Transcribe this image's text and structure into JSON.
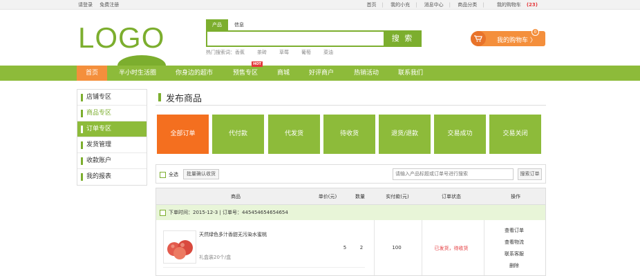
{
  "topbar": {
    "login": "请登录",
    "register": "免费注册",
    "links": [
      "首页",
      "我的小充",
      "消息中心",
      "商品分类",
      "我的购物车"
    ],
    "cart_count": "(23)"
  },
  "header": {
    "logo": "LOGO",
    "search_tabs": [
      "产品",
      "信息"
    ],
    "search_button": "搜 索",
    "hot_label": "热门搜索词：",
    "hot_words": [
      "香蕉",
      "茶砖",
      "草莓",
      "葡萄",
      "菜油"
    ],
    "cart_label": "我的购物车 〉",
    "cart_badge": "0",
    "cart_icon": "shopping-cart-icon"
  },
  "nav": {
    "items": [
      "首页",
      "半小时生活圈",
      "你身边的超市",
      "预售专区",
      "商城",
      "好评商户",
      "热销活动",
      "联系我们"
    ],
    "hot_tag": "HOT"
  },
  "sidebar": {
    "items": [
      "店铺专区",
      "商品专区",
      "订单专区",
      "发货管理",
      "收款账户",
      "我的报表"
    ]
  },
  "main": {
    "title": "发布商品",
    "status_tiles": [
      "全部订单",
      "代付款",
      "代发货",
      "待收货",
      "退货/退款",
      "交易成功",
      "交易关闭"
    ],
    "toolbar": {
      "select_all": "全选",
      "batch_confirm": "批量确认收货",
      "search_placeholder": "请输入产品标题或订单号进行搜索",
      "search_button": "搜索订单"
    },
    "table": {
      "headers": [
        "商品",
        "单价(元)",
        "数量",
        "实付款(元)",
        "订单状态",
        "操作"
      ],
      "order_info": "下单时间：2015-12-3 | 订单号：445454654654654",
      "row": {
        "product_name": "天然绿色多汁香甜无污染水蜜桃",
        "product_spec": "礼盒装20个/盒",
        "unit_price": "5",
        "quantity": "2",
        "paid": "100",
        "status": "已发货，待收货",
        "actions": [
          "查看订单",
          "查看物流",
          "联系客服",
          "删除"
        ]
      }
    }
  },
  "colors": {
    "brand_green": "#8dbb3a",
    "accent_orange": "#f46f1f",
    "alert_red": "#e4393c"
  }
}
